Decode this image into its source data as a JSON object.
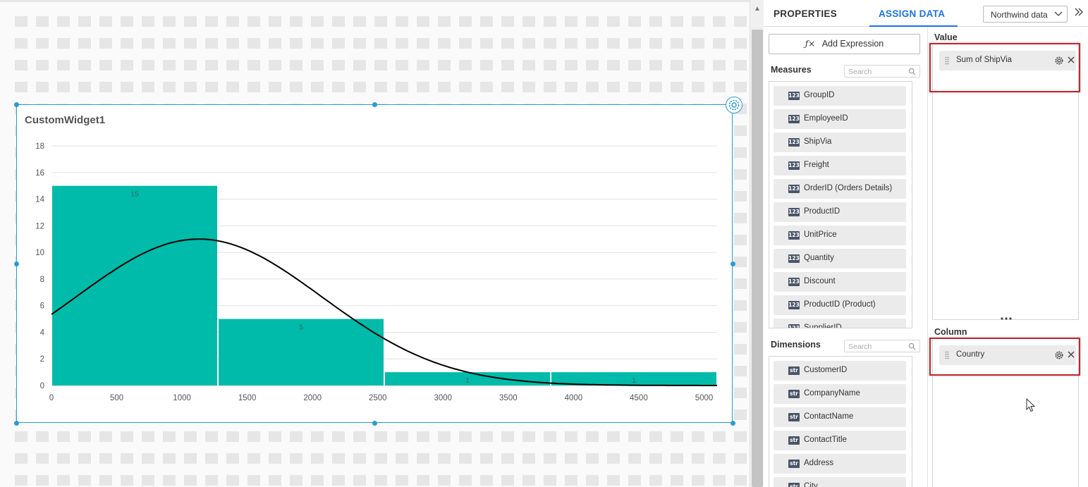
{
  "canvas": {
    "widget": {
      "title": "CustomWidget1"
    }
  },
  "chart_data": {
    "type": "bar",
    "subtype": "histogram with normal distribution curve",
    "bins": [
      {
        "x0": 0,
        "x1": 1275,
        "value": 15
      },
      {
        "x0": 1275,
        "x1": 2550,
        "value": 5
      },
      {
        "x0": 2550,
        "x1": 3825,
        "value": 1
      },
      {
        "x0": 3825,
        "x1": 5100,
        "value": 1
      }
    ],
    "data_labels": [
      "15",
      "5",
      "1",
      "1"
    ],
    "curve": {
      "name": "Normal distribution",
      "mean": 1130,
      "stddev": 940,
      "peak": 11,
      "color": "#000000"
    },
    "bar_color": "#00bba9",
    "xlim": [
      0,
      5100
    ],
    "ylim": [
      0,
      18
    ],
    "x_ticks": [
      0,
      500,
      1000,
      1500,
      2000,
      2500,
      3000,
      3500,
      4000,
      4500,
      5000
    ],
    "y_ticks": [
      0,
      2,
      4,
      6,
      8,
      10,
      12,
      14,
      16,
      18
    ],
    "grid": "horizontal",
    "legend": "none",
    "title": "",
    "xlabel": "",
    "ylabel": ""
  },
  "panel": {
    "tabs": {
      "properties": "PROPERTIES",
      "assign_data": "ASSIGN DATA",
      "active": "ASSIGN DATA"
    },
    "datasource": "Northwind data",
    "collapse_icon": "double-chevron-right-icon",
    "add_expression": "Add Expression",
    "add_expression_icon": "fx-icon",
    "measures": {
      "label": "Measures",
      "search_placeholder": "Search",
      "badge": "123",
      "items": [
        "GroupID",
        "EmployeeID",
        "ShipVia",
        "Freight",
        "OrderID (Orders Details)",
        "ProductID",
        "UnitPrice",
        "Quantity",
        "Discount",
        "ProductID (Product)",
        "SupplierID"
      ]
    },
    "dimensions": {
      "label": "Dimensions",
      "search_placeholder": "Search",
      "badge": "str",
      "items": [
        "CustomerID",
        "CompanyName",
        "ContactName",
        "ContactTitle",
        "Address",
        "City"
      ]
    },
    "value": {
      "label": "Value",
      "item": "Sum of ShipVia"
    },
    "column": {
      "label": "Column",
      "item": "Country"
    },
    "accent_color": "#1a73e8",
    "highlight_color": "#c6262e"
  }
}
